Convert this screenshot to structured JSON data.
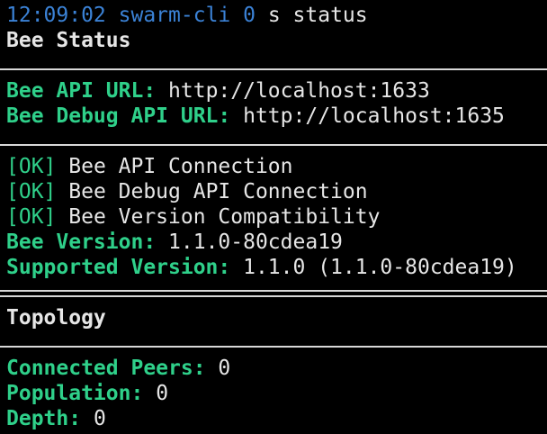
{
  "prompt": {
    "time": "12:09:02",
    "cwd": "swarm-cli",
    "exit_code": "0",
    "command": "s status"
  },
  "sections": {
    "bee_status_title": "Bee Status",
    "topology_title": "Topology"
  },
  "api": {
    "api_url_label": "Bee API URL:",
    "api_url_value": "http://localhost:1633",
    "debug_url_label": "Bee Debug API URL:",
    "debug_url_value": "http://localhost:1635"
  },
  "checks": [
    {
      "status": "[OK]",
      "label": "Bee API Connection"
    },
    {
      "status": "[OK]",
      "label": "Bee Debug API Connection"
    },
    {
      "status": "[OK]",
      "label": "Bee Version Compatibility"
    }
  ],
  "versions": {
    "bee_version_label": "Bee Version:",
    "bee_version_value": "1.1.0-80cdea19",
    "supported_version_label": "Supported Version:",
    "supported_version_value": "1.1.0 (1.1.0-80cdea19)"
  },
  "topology": {
    "connected_peers_label": "Connected Peers:",
    "connected_peers_value": "0",
    "population_label": "Population:",
    "population_value": "0",
    "depth_label": "Depth:",
    "depth_value": "0"
  },
  "colors": {
    "background": "#000000",
    "prompt_blue": "#3b82d6",
    "key_green": "#2fd08a",
    "text": "#e6e6e6"
  }
}
